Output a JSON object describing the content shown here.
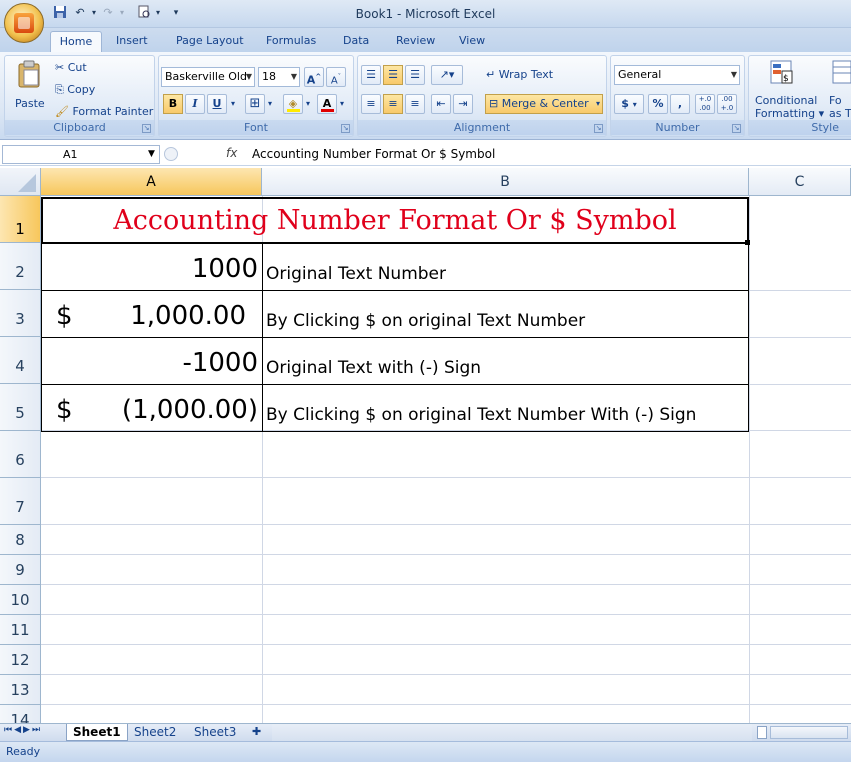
{
  "window": {
    "title": "Book1 - Microsoft Excel"
  },
  "ribbon_tabs": [
    "Home",
    "Insert",
    "Page Layout",
    "Formulas",
    "Data",
    "Review",
    "View"
  ],
  "active_tab": "Home",
  "clipboard": {
    "paste": "Paste",
    "cut": "Cut",
    "copy": "Copy",
    "format_painter": "Format Painter",
    "label": "Clipboard"
  },
  "font": {
    "name": "Baskerville Old",
    "size": "18",
    "bold": "B",
    "italic": "I",
    "underline": "U",
    "label": "Font"
  },
  "alignment": {
    "wrap_text": "Wrap Text",
    "merge_center": "Merge & Center",
    "label": "Alignment"
  },
  "number": {
    "format": "General",
    "currency": "$",
    "percent": "%",
    "comma": ",",
    "inc_decimal": "+.0 .00",
    "dec_decimal": ".00 +.0",
    "label": "Number"
  },
  "styles": {
    "conditional": "Conditional",
    "formatting": "Formatting",
    "format_as": "Fo",
    "as_table": "as T",
    "label": "Style"
  },
  "formula_bar": {
    "name_box": "A1",
    "fx": "fx",
    "content": "Accounting Number Format Or $ Symbol"
  },
  "columns": [
    "A",
    "B",
    "C"
  ],
  "rows": [
    "1",
    "2",
    "3",
    "4",
    "5",
    "6",
    "7",
    "8",
    "9",
    "10",
    "11",
    "12",
    "13",
    "14"
  ],
  "cells": {
    "title": "Accounting Number Format Or $ Symbol",
    "r2": {
      "a": "1000",
      "b": "Original Text Number"
    },
    "r3": {
      "a_symbol": "$",
      "a_value": "1,000.00",
      "b": "By Clicking $ on original Text Number"
    },
    "r4": {
      "a": "-1000",
      "b": "Original Text with (-) Sign"
    },
    "r5": {
      "a_symbol": "$",
      "a_value": "(1,000.00)",
      "b": "By Clicking $ on original Text Number With (-) Sign"
    }
  },
  "sheets": [
    "Sheet1",
    "Sheet2",
    "Sheet3"
  ],
  "active_sheet": "Sheet1",
  "status": "Ready",
  "colors": {
    "title_text": "#e0001b",
    "ribbon_blue": "#15428b",
    "selected_header": "#f7c75c"
  }
}
